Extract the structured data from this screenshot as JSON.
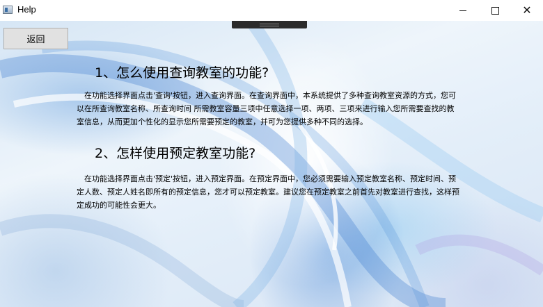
{
  "window": {
    "title": "Help",
    "icon": "app-window-icon",
    "minimize_icon": "minimize-icon",
    "maximize_icon": "maximize-icon",
    "close_icon": "close-icon",
    "close_glyph": "✕"
  },
  "toolbar": {
    "back_label": "返回"
  },
  "help": {
    "sections": [
      {
        "heading": "1、怎么使用查询教室的功能?",
        "body": "在功能选择界面点击'查询'按钮，进入查询界面。在查询界面中，本系统提供了多种查询教室资源的方式，您可以在所查询教室名称、所查询时间 所需教室容量三项中任意选择一项、两项、三项来进行输入您所需要查找的教室信息，从而更加个性化的显示您所需要预定的教室，并可为您提供多种不同的选择。"
      },
      {
        "heading": "2、怎样使用预定教室功能?",
        "body": "在功能选择界面点击'预定'按钮，进入预定界面。在预定界面中，您必须需要输入预定教室名称、预定时间、预定人数、预定人姓名即所有的预定信息，您才可以预定教室。建议您在预定教室之前首先对教室进行查找，这样预定成功的可能性会更大。"
      }
    ]
  }
}
